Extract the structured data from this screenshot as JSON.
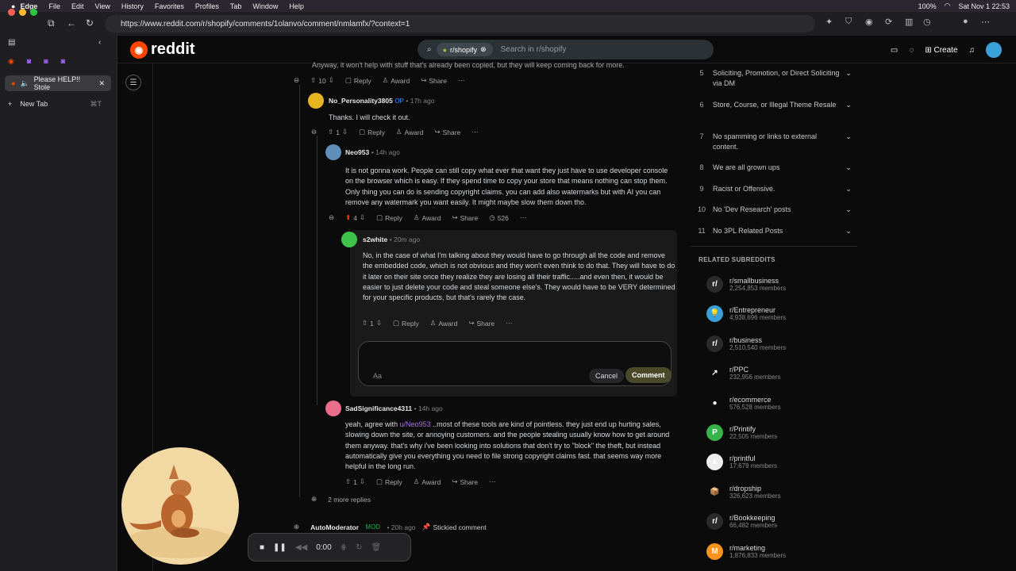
{
  "menubar": {
    "app": "Edge",
    "items": [
      "File",
      "Edit",
      "View",
      "History",
      "Favorites",
      "Profiles",
      "Tab",
      "Window",
      "Help"
    ],
    "battery": "100%",
    "datetime": "Sat Nov 1  22:53"
  },
  "browser": {
    "url": "https://www.reddit.com/r/shopify/comments/1olanvo/comment/nmlamfx/?context=1",
    "active_tab": "Please HELP!! Stole",
    "new_tab": "New Tab",
    "new_tab_shortcut": "⌘T"
  },
  "header": {
    "logo": "reddit",
    "search_chip": "r/shopify",
    "search_placeholder": "Search in r/shopify",
    "create": "Create"
  },
  "comments": [
    {
      "text": "Anyway, it won't help with stuff that's already been copied, but they will keep coming back for more.",
      "votes": "10"
    },
    {
      "author": "No_Personality3805",
      "badge": "OP",
      "time": "• 17h ago",
      "text": "Thanks. I will check it out.",
      "votes": "1"
    },
    {
      "author": "Neo953",
      "time": "• 14h ago",
      "text": "It is not gonna work. People can still copy what ever that want they just have to use developer console on the browser which is easy. If they spend time to copy your store that means nothing can stop them. Only thing you can do is sending copyright claims. you can add also watermarks but with AI you can remove any watermark you want easily. It might maybe slow them down tho.",
      "votes": "4",
      "extra": "526"
    },
    {
      "author": "s2white",
      "time": "• 20m ago",
      "text": "No, in the case of what I'm talking about they would have to go through all the code and remove the embedded code, which is not obvious and they won't even think to do that. They will have to do it later on their site once they realize they are losing all their traffic.....and even then, it would be easier to just delete your code and steal someone else's. They would have to be VERY determined for your specific products, but that's rarely the case.",
      "votes": "1"
    },
    {
      "author": "SadSignificance4311",
      "time": "• 14h ago",
      "mention": "u/Neo953",
      "text": " ..most of these tools are kind of pointless. they just end up hurting sales, slowing down the site, or annoying customers. and the people stealing usually know how to get around them anyway. that's why i've been looking into solutions that don't try to \"block\" the theft, but instead automatically give you everything you need to file strong copyright claims fast. that seems way more helpful in the long run.",
      "prefix": "yeah, agree with ",
      "votes": "1"
    },
    {
      "author": "AutoModerator",
      "badge": "MOD",
      "time": "• 20h ago",
      "pinned": "Stickied comment"
    }
  ],
  "labels": {
    "reply": "Reply",
    "award": "Award",
    "share": "Share",
    "more_replies": "2 more replies",
    "cancel": "Cancel",
    "comment": "Comment",
    "aa": "Aa"
  },
  "rules": [
    {
      "n": "5",
      "t": "Soliciting, Promotion, or Direct Soliciting via DM"
    },
    {
      "n": "6",
      "t": "Store, Course, or Illegal Theme Resale"
    },
    {
      "n": "7",
      "t": "No spamming or links to external content."
    },
    {
      "n": "8",
      "t": "We are all grown ups"
    },
    {
      "n": "9",
      "t": "Racist or Offensive."
    },
    {
      "n": "10",
      "t": "No 'Dev Research' posts"
    },
    {
      "n": "11",
      "t": "No 3PL Related Posts"
    }
  ],
  "related_title": "RELATED SUBREDDITS",
  "related": [
    {
      "name": "r/smallbusiness",
      "members": "2,254,853 members",
      "color": "#2a2a2a",
      "glyph": "r/"
    },
    {
      "name": "r/Entrepreneur",
      "members": "4,938,696 members",
      "color": "#3ba0d8",
      "glyph": "💡"
    },
    {
      "name": "r/business",
      "members": "2,510,540 members",
      "color": "#2a2a2a",
      "glyph": "r/"
    },
    {
      "name": "r/PPC",
      "members": "232,956 members",
      "color": "#0b0b0c",
      "glyph": "↗"
    },
    {
      "name": "r/ecommerce",
      "members": "576,528 members",
      "color": "#0b0b0c",
      "glyph": "●"
    },
    {
      "name": "r/Printify",
      "members": "22,505 members",
      "color": "#38b24a",
      "glyph": "P"
    },
    {
      "name": "r/printful",
      "members": "17,679 members",
      "color": "#eeeeee",
      "glyph": "▲"
    },
    {
      "name": "r/dropship",
      "members": "326,623 members",
      "color": "#0b0b0c",
      "glyph": "📦"
    },
    {
      "name": "r/Bookkeeping",
      "members": "66,482 members",
      "color": "#2a2a2a",
      "glyph": "r/"
    },
    {
      "name": "r/marketing",
      "members": "1,876,833 members",
      "color": "#f7931e",
      "glyph": "M"
    }
  ],
  "recorder": {
    "time": "0:00"
  }
}
